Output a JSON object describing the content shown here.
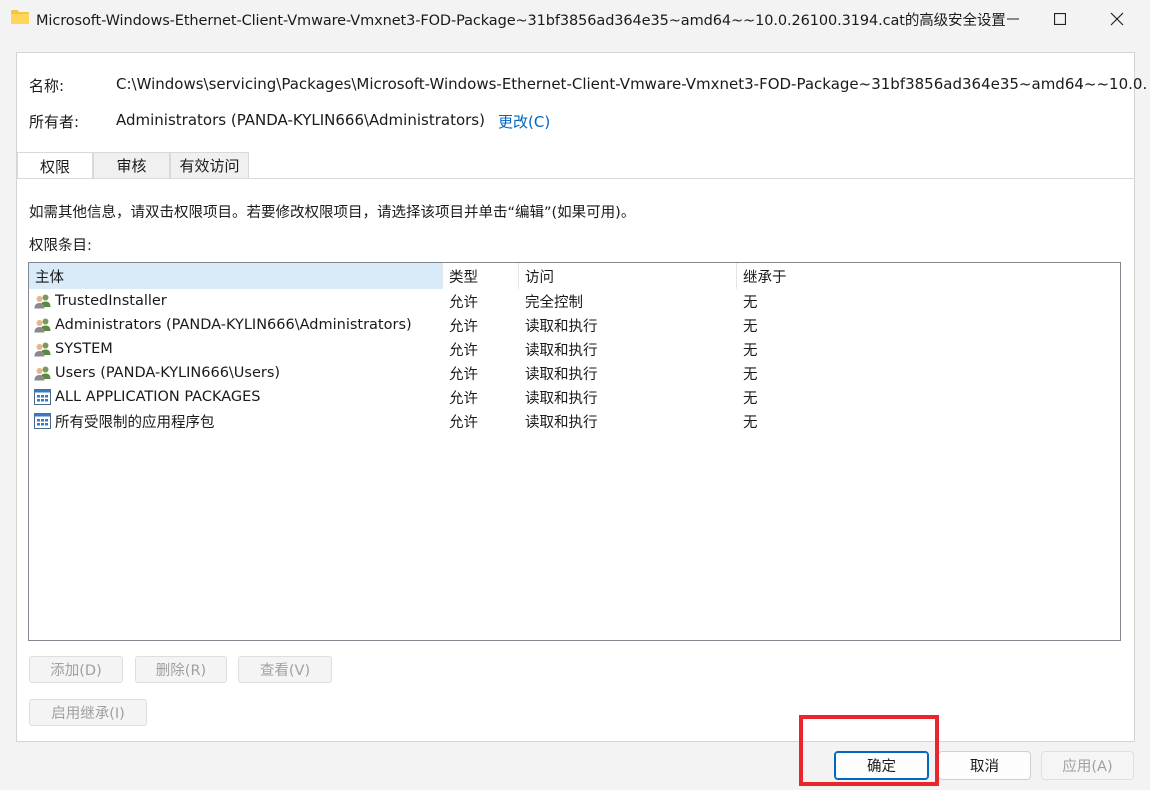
{
  "window": {
    "title": "Microsoft-Windows-Ethernet-Client-Vmware-Vmxnet3-FOD-Package~31bf3856ad364e35~amd64~~10.0.26100.3194.cat的高级安全设置"
  },
  "header": {
    "name_label": "名称:",
    "name_value": "C:\\Windows\\servicing\\Packages\\Microsoft-Windows-Ethernet-Client-Vmware-Vmxnet3-FOD-Package~31bf3856ad364e35~amd64~~10.0.",
    "owner_label": "所有者:",
    "owner_value": "Administrators (PANDA-KYLIN666\\Administrators)",
    "change_link": "更改(C)"
  },
  "tabs": [
    {
      "label": "权限",
      "active": true
    },
    {
      "label": "审核",
      "active": false
    },
    {
      "label": "有效访问",
      "active": false
    }
  ],
  "permissions": {
    "info_text": "如需其他信息，请双击权限项目。若要修改权限项目，请选择该项目并单击“编辑”(如果可用)。",
    "entries_label": "权限条目:",
    "columns": [
      "主体",
      "类型",
      "访问",
      "继承于"
    ],
    "rows": [
      {
        "principal": "TrustedInstaller",
        "icon": "user-group-icon",
        "type": "允许",
        "access": "完全控制",
        "inherited": "无"
      },
      {
        "principal": "Administrators (PANDA-KYLIN666\\Administrators)",
        "icon": "user-group-icon",
        "type": "允许",
        "access": "读取和执行",
        "inherited": "无"
      },
      {
        "principal": "SYSTEM",
        "icon": "user-group-icon",
        "type": "允许",
        "access": "读取和执行",
        "inherited": "无"
      },
      {
        "principal": "Users (PANDA-KYLIN666\\Users)",
        "icon": "user-group-icon",
        "type": "允许",
        "access": "读取和执行",
        "inherited": "无"
      },
      {
        "principal": "ALL APPLICATION PACKAGES",
        "icon": "app-package-icon",
        "type": "允许",
        "access": "读取和执行",
        "inherited": "无"
      },
      {
        "principal": "所有受限制的应用程序包",
        "icon": "app-package-icon",
        "type": "允许",
        "access": "读取和执行",
        "inherited": "无"
      }
    ],
    "buttons": {
      "add": "添加(D)",
      "remove": "删除(R)",
      "view": "查看(V)",
      "enable_inheritance": "启用继承(I)"
    }
  },
  "footer": {
    "ok": "确定",
    "cancel": "取消",
    "apply": "应用(A)"
  },
  "colors": {
    "accent": "#0067c0",
    "highlight": "#e8262b",
    "sorted_column": "#d9ebf9"
  }
}
